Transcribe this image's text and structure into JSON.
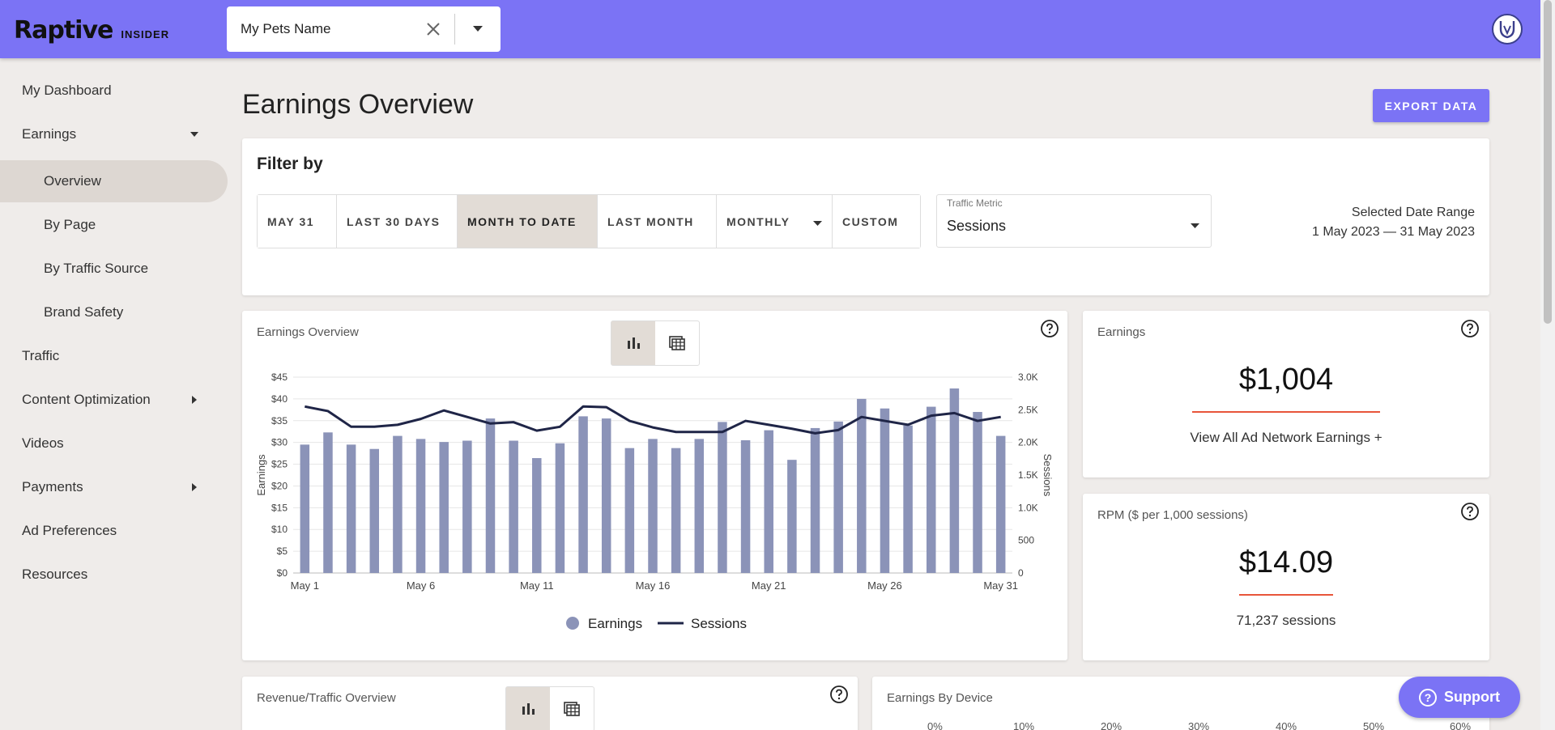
{
  "header": {
    "brand": "Raptive",
    "brand_sub": "INSIDER",
    "site_select": {
      "value": "My Pets Name"
    }
  },
  "sidebar": {
    "items": [
      {
        "label": "My Dashboard"
      },
      {
        "label": "Earnings",
        "expanded": true
      },
      {
        "label": "Overview",
        "active": true
      },
      {
        "label": "By Page"
      },
      {
        "label": "By Traffic Source"
      },
      {
        "label": "Brand Safety"
      },
      {
        "label": "Traffic"
      },
      {
        "label": "Content Optimization"
      },
      {
        "label": "Videos"
      },
      {
        "label": "Payments"
      },
      {
        "label": "Ad Preferences"
      },
      {
        "label": "Resources"
      }
    ]
  },
  "main": {
    "title": "Earnings Overview",
    "export_label": "EXPORT DATA"
  },
  "filter": {
    "title": "Filter by",
    "ranges": [
      "MAY 31",
      "LAST 30 DAYS",
      "MONTH TO DATE",
      "LAST MONTH",
      "MONTHLY",
      "CUSTOM"
    ],
    "selected_range": "MONTH TO DATE",
    "metric_label": "Traffic Metric",
    "metric_value": "Sessions",
    "date_range_label": "Selected Date Range",
    "date_range_value": "1 May 2023 — 31 May 2023"
  },
  "earnings_chart_card": {
    "title": "Earnings Overview"
  },
  "earnings_card": {
    "title": "Earnings",
    "value": "$1,004",
    "link": "View All Ad Network Earnings +"
  },
  "rpm_card": {
    "title": "RPM ($ per 1,000 sessions)",
    "value": "$14.09",
    "sub": "71,237 sessions"
  },
  "revenue_card": {
    "title": "Revenue/Traffic Overview"
  },
  "device_card": {
    "title": "Earnings By Device",
    "axis": [
      "0%",
      "10%",
      "20%",
      "30%",
      "40%",
      "50%",
      "60%"
    ]
  },
  "support": {
    "label": "Support"
  },
  "colors": {
    "accent": "#7b73f5",
    "bar": "#8b93b8",
    "line": "#1f2547",
    "underline": "#e8553a"
  },
  "chart_data": {
    "type": "bar",
    "categories": [
      "May 1",
      "May 2",
      "May 3",
      "May 4",
      "May 5",
      "May 6",
      "May 7",
      "May 8",
      "May 9",
      "May 10",
      "May 11",
      "May 12",
      "May 13",
      "May 14",
      "May 15",
      "May 16",
      "May 17",
      "May 18",
      "May 19",
      "May 20",
      "May 21",
      "May 22",
      "May 23",
      "May 24",
      "May 25",
      "May 26",
      "May 27",
      "May 28",
      "May 29",
      "May 30",
      "May 31"
    ],
    "xticks": [
      "May 1",
      "May 6",
      "May 11",
      "May 16",
      "May 21",
      "May 26",
      "May 31"
    ],
    "series": [
      {
        "name": "Earnings",
        "type": "bar",
        "axis": "left",
        "values": [
          29.5,
          32.3,
          29.5,
          28.5,
          31.5,
          30.8,
          30.1,
          30.4,
          35.5,
          30.4,
          26.4,
          29.8,
          36.0,
          35.5,
          28.7,
          30.8,
          28.7,
          30.8,
          34.7,
          30.5,
          32.8,
          26.0,
          33.3,
          34.8,
          40.0,
          37.8,
          33.9,
          38.2,
          42.4,
          37.0,
          31.5
        ]
      },
      {
        "name": "Sessions",
        "type": "line",
        "axis": "right",
        "values": [
          2550,
          2480,
          2240,
          2240,
          2270,
          2360,
          2490,
          2390,
          2290,
          2310,
          2180,
          2240,
          2550,
          2540,
          2330,
          2230,
          2160,
          2160,
          2160,
          2330,
          2270,
          2210,
          2140,
          2190,
          2390,
          2330,
          2270,
          2410,
          2450,
          2330,
          2390
        ]
      }
    ],
    "ylabel": "Earnings",
    "y2label": "Sessions",
    "ylim": [
      0,
      45
    ],
    "y2lim": [
      0,
      3000
    ],
    "yticks": [
      "$0",
      "$5",
      "$10",
      "$15",
      "$20",
      "$25",
      "$30",
      "$35",
      "$40",
      "$45"
    ],
    "y2ticks": [
      "0",
      "500",
      "1.0K",
      "1.5K",
      "2.0K",
      "2.5K",
      "3.0K"
    ],
    "legend": "bottom",
    "grid": true
  }
}
